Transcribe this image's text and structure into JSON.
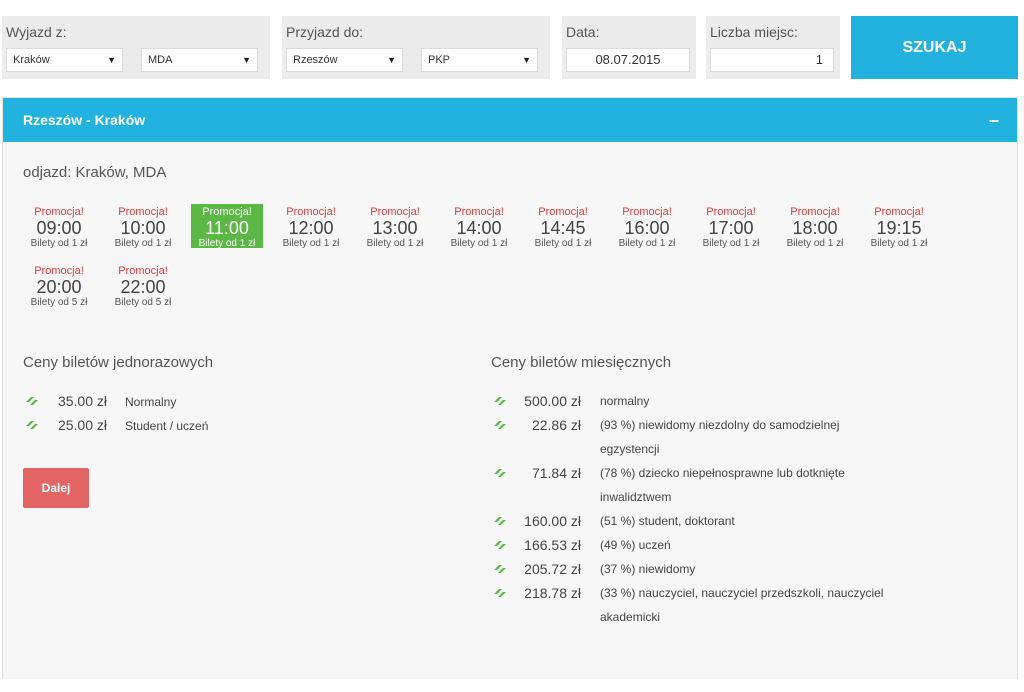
{
  "search": {
    "from_label": "Wyjazd z:",
    "from_city": "Kraków",
    "from_station": "MDA",
    "to_label": "Przyjazd do:",
    "to_city": "Rzeszów",
    "to_station": "PKP",
    "date_label": "Data:",
    "date_value": "08.07.2015",
    "seats_label": "Liczba miejsc:",
    "seats_value": "1",
    "search_button": "SZUKAJ"
  },
  "panel": {
    "title": "Rzeszów - Kraków",
    "collapse_symbol": "–",
    "departure": "odjazd: Kraków, MDA"
  },
  "times": [
    {
      "promo": "Promocja!",
      "time": "09:00",
      "price": "Bilety od 1 zł",
      "active": false
    },
    {
      "promo": "Promocja!",
      "time": "10:00",
      "price": "Bilety od 1 zł",
      "active": false
    },
    {
      "promo": "Promocja!",
      "time": "11:00",
      "price": "Bilety od 1 zł",
      "active": true
    },
    {
      "promo": "Promocja!",
      "time": "12:00",
      "price": "Bilety od 1 zł",
      "active": false
    },
    {
      "promo": "Promocja!",
      "time": "13:00",
      "price": "Bilety od 1 zł",
      "active": false
    },
    {
      "promo": "Promocja!",
      "time": "14:00",
      "price": "Bilety od 1 zł",
      "active": false
    },
    {
      "promo": "Promocja!",
      "time": "14:45",
      "price": "Bilety od 1 zł",
      "active": false
    },
    {
      "promo": "Promocja!",
      "time": "16:00",
      "price": "Bilety od 1 zł",
      "active": false
    },
    {
      "promo": "Promocja!",
      "time": "17:00",
      "price": "Bilety od 1 zł",
      "active": false
    },
    {
      "promo": "Promocja!",
      "time": "18:00",
      "price": "Bilety od 1 zł",
      "active": false
    },
    {
      "promo": "Promocja!",
      "time": "19:15",
      "price": "Bilety od 1 zł",
      "active": false
    },
    {
      "promo": "Promocja!",
      "time": "20:00",
      "price": "Bilety od 5 zł",
      "active": false
    },
    {
      "promo": "Promocja!",
      "time": "22:00",
      "price": "Bilety od 5 zł",
      "active": false
    }
  ],
  "single": {
    "title": "Ceny biletów jednorazowych",
    "items": [
      {
        "amount": "35.00 zł",
        "label": "Normalny"
      },
      {
        "amount": "25.00 zł",
        "label": "Student / uczeń"
      }
    ]
  },
  "monthly": {
    "title": "Ceny biletów miesięcznych",
    "items": [
      {
        "amount": "500.00 zł",
        "label": "normalny"
      },
      {
        "amount": "22.86 zł",
        "label": "(93 %) niewidomy niezdolny do samodzielnej egzystencji"
      },
      {
        "amount": "71.84 zł",
        "label": "(78 %) dziecko niepełnosprawne lub dotknięte inwalidztwem"
      },
      {
        "amount": "160.00 zł",
        "label": "(51 %) student, doktorant"
      },
      {
        "amount": "166.53 zł",
        "label": "(49 %) uczeń"
      },
      {
        "amount": "205.72 zł",
        "label": "(37 %) niewidomy"
      },
      {
        "amount": "218.78 zł",
        "label": "(33 %) nauczyciel, nauczyciel przedszkoli, nauczyciel akademicki"
      }
    ]
  },
  "next_button": "Dalej",
  "colors": {
    "accent": "#21b2e0",
    "active_slot": "#5cb845",
    "promo": "#e2393b",
    "next": "#e36565",
    "tick": "#5cb845"
  },
  "icons": {
    "ticket": "ticket-icon",
    "dropdown": "chevron-down-icon"
  }
}
